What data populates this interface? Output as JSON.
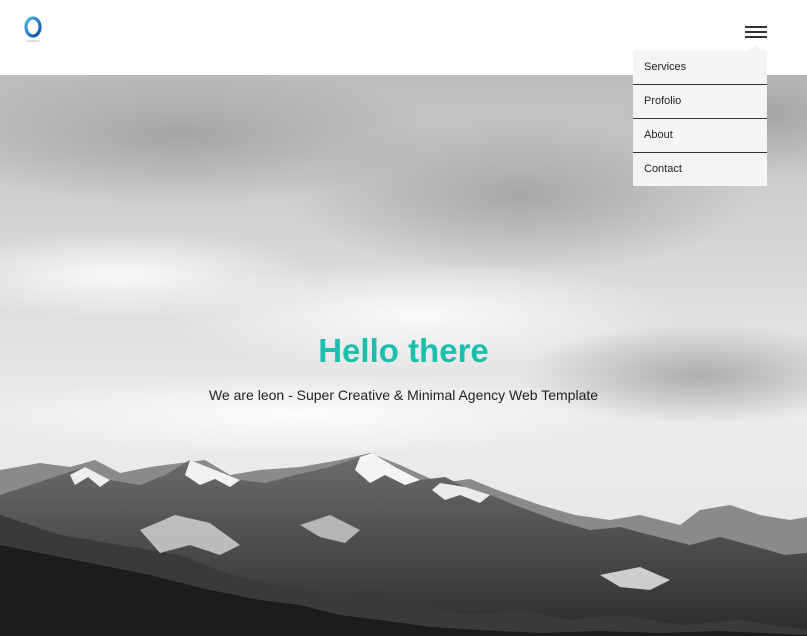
{
  "header": {
    "logo_icon": "blue-ring-logo",
    "menu_icon": "hamburger-icon"
  },
  "nav_menu": {
    "items": [
      {
        "label": "Services"
      },
      {
        "label": "Profolio"
      },
      {
        "label": "About"
      },
      {
        "label": "Contact"
      }
    ]
  },
  "hero": {
    "title": "Hello there",
    "subtitle": "We are leon - Super Creative & Minimal Agency Web Template",
    "background": "black-and-white snowy mountains under cloudy sky"
  },
  "colors": {
    "accent": "#1cbfae",
    "logo_blue": "#1a73c9",
    "menu_bg": "#f5f5f5",
    "text_dark": "#222222"
  }
}
